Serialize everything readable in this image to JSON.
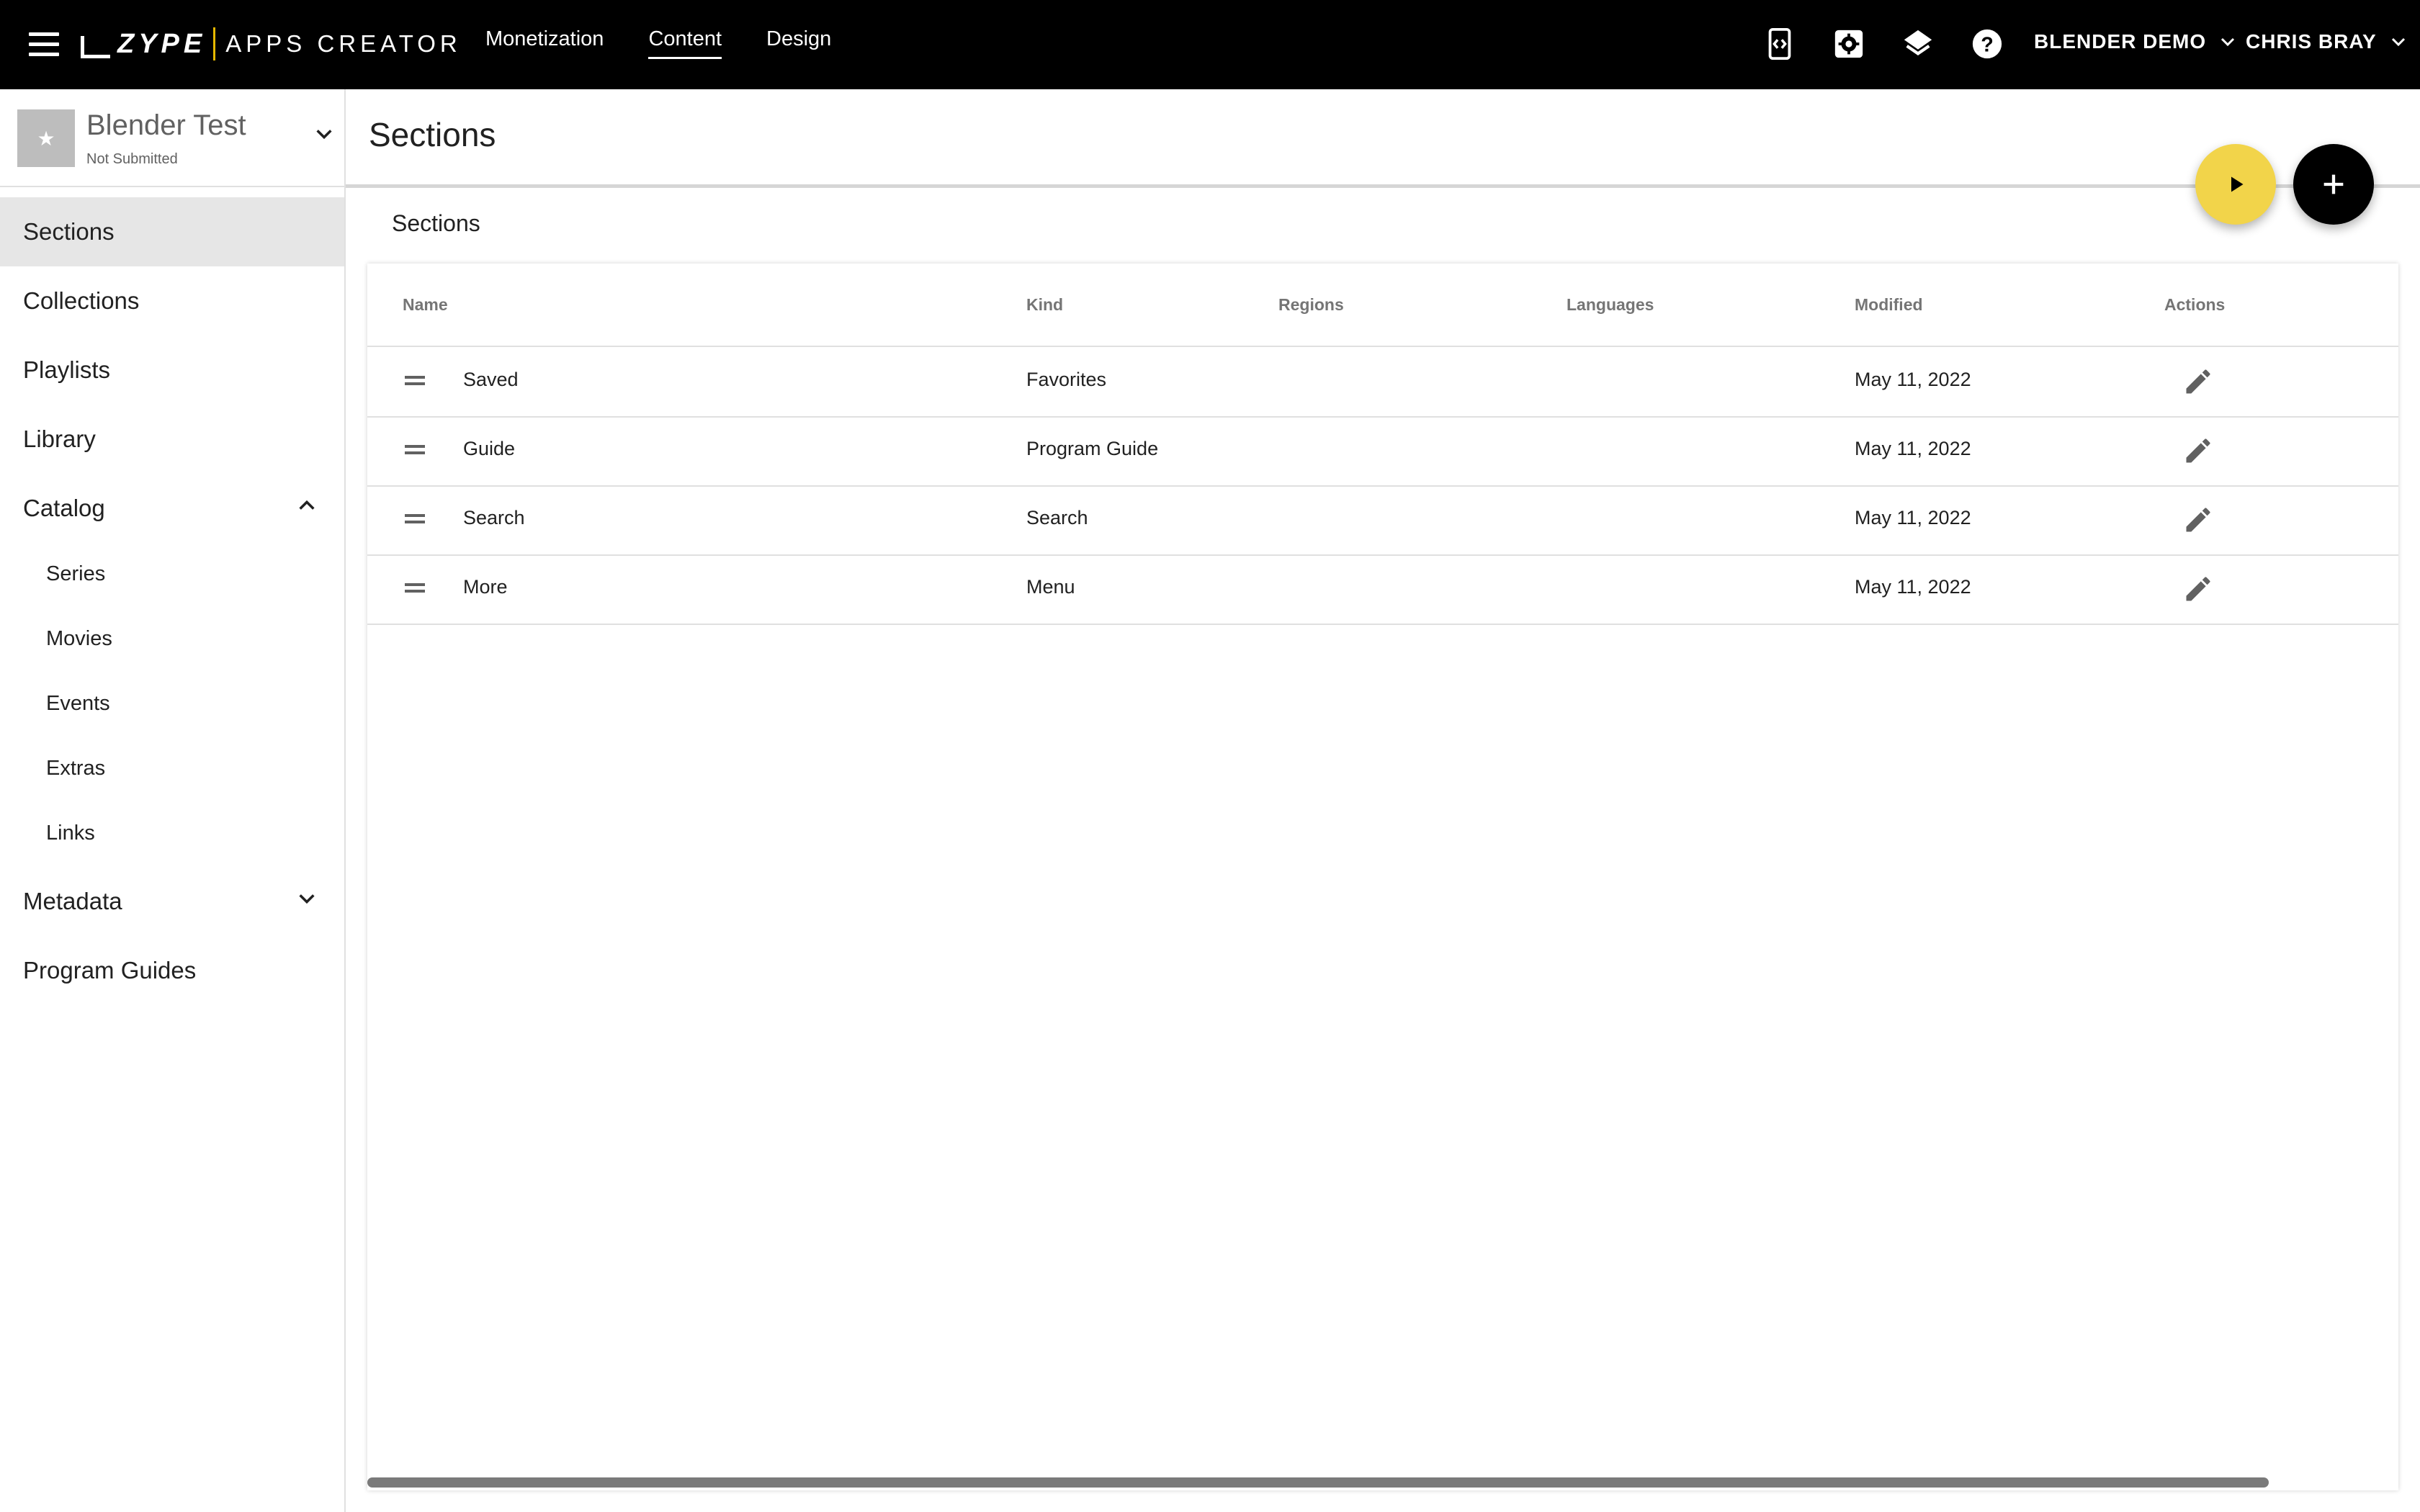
{
  "brand": {
    "logo_text": "ZYPE",
    "product": "APPS CREATOR"
  },
  "nav": [
    {
      "label": "Monetization",
      "active": false
    },
    {
      "label": "Content",
      "active": true
    },
    {
      "label": "Design",
      "active": false
    }
  ],
  "toolbar_icons": [
    "app-preview-icon",
    "settings-icon",
    "layers-icon",
    "help-icon"
  ],
  "account": {
    "org": "BLENDER DEMO",
    "user": "CHRIS BRAY"
  },
  "app": {
    "name": "Blender Test",
    "status": "Not Submitted"
  },
  "sidebar": {
    "items": [
      {
        "label": "Sections",
        "active": true
      },
      {
        "label": "Collections"
      },
      {
        "label": "Playlists"
      },
      {
        "label": "Library"
      },
      {
        "label": "Catalog",
        "expanded": true
      },
      {
        "label": "Metadata",
        "expanded": false
      },
      {
        "label": "Program Guides"
      }
    ],
    "catalog_children": [
      "Series",
      "Movies",
      "Events",
      "Extras",
      "Links"
    ]
  },
  "page": {
    "title": "Sections",
    "card_title": "Sections"
  },
  "table": {
    "columns": [
      "Name",
      "Kind",
      "Regions",
      "Languages",
      "Modified",
      "Actions"
    ],
    "rows": [
      {
        "name": "Saved",
        "kind": "Favorites",
        "regions": "",
        "languages": "",
        "modified": "May 11, 2022"
      },
      {
        "name": "Guide",
        "kind": "Program Guide",
        "regions": "",
        "languages": "",
        "modified": "May 11, 2022"
      },
      {
        "name": "Search",
        "kind": "Search",
        "regions": "",
        "languages": "",
        "modified": "May 11, 2022"
      },
      {
        "name": "More",
        "kind": "Menu",
        "regions": "",
        "languages": "",
        "modified": "May 11, 2022"
      }
    ]
  },
  "colors": {
    "topbar": "#000000",
    "accent_yellow": "#f2d44a",
    "active_item_bg": "#e6e6e6"
  }
}
